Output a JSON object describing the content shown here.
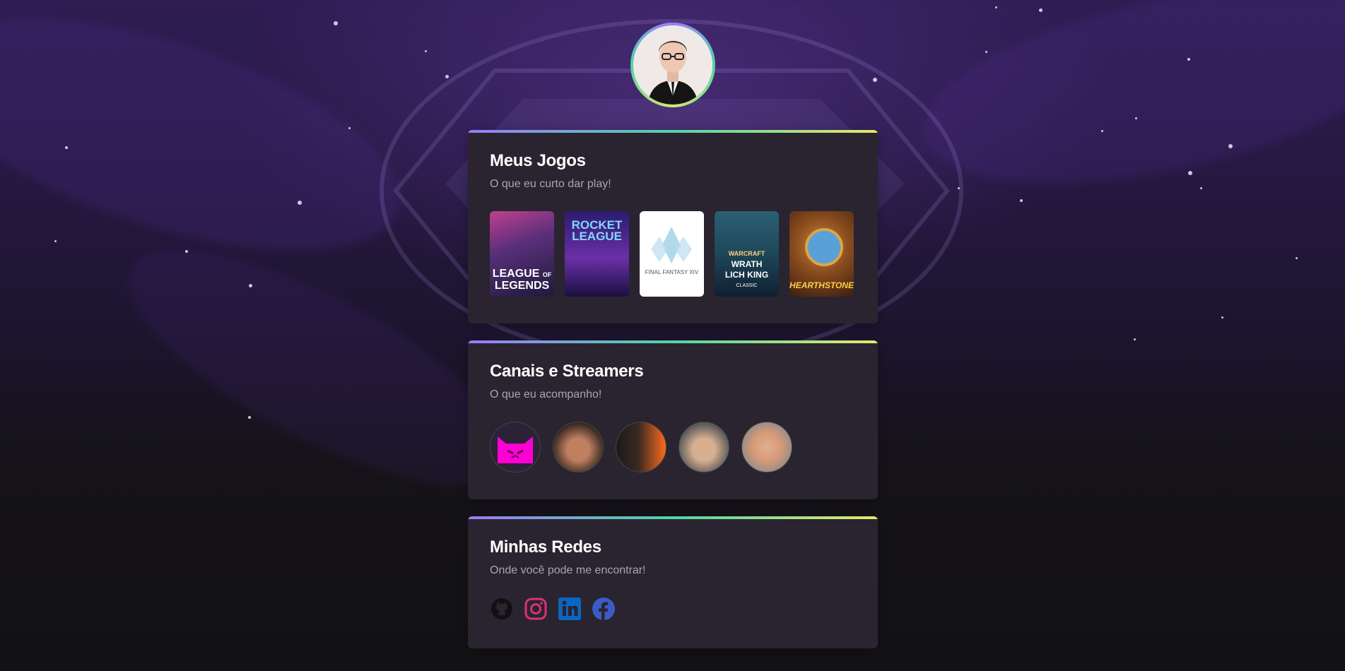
{
  "profile": {
    "avatar_alt": ""
  },
  "sections": {
    "games": {
      "title": "Meus Jogos",
      "subtitle": "O que eu curto dar play!",
      "items": [
        {
          "name": "League of Legends",
          "label_line1": "LEAGUE",
          "label_line2": "LEGENDS",
          "of": "OF",
          "colors": [
            "#5a2f7a",
            "#1d1a3a"
          ]
        },
        {
          "name": "Rocket League",
          "label_line1": "ROCKET",
          "label_line2": "LEAGUE",
          "colors": [
            "#2b1c6e",
            "#6a2fa8"
          ]
        },
        {
          "name": "Final Fantasy XIV",
          "label_line1": "FINAL FANTASY XIV",
          "colors": [
            "#ffffff",
            "#ffffff"
          ]
        },
        {
          "name": "World of Warcraft Wrath of the Lich King Classic",
          "label_line1": "WARCRAFT",
          "label_line2": "WRATH",
          "label_line3": "LICH KING",
          "label_line4": "CLASSIC",
          "colors": [
            "#1f4a5c",
            "#0f2030"
          ]
        },
        {
          "name": "Hearthstone",
          "label_line1": "HEARTHSTONE",
          "colors": [
            "#7a3f1a",
            "#3a1e10"
          ]
        }
      ]
    },
    "streamers": {
      "title": "Canais e Streamers",
      "subtitle": "O que eu acompanho!",
      "items": [
        {
          "name": "streamer-1",
          "colors": [
            "#2b2238",
            "#ff00d4"
          ]
        },
        {
          "name": "streamer-2",
          "colors": [
            "#3a2a22",
            "#c08060"
          ]
        },
        {
          "name": "streamer-3",
          "colors": [
            "#1a1a1a",
            "#ff6a1a"
          ]
        },
        {
          "name": "streamer-4",
          "colors": [
            "#5a5a5a",
            "#d8b090"
          ]
        },
        {
          "name": "streamer-5",
          "colors": [
            "#8a8a8a",
            "#e0b090"
          ]
        }
      ]
    },
    "networks": {
      "title": "Minhas Redes",
      "subtitle": "Onde você pode me encontrar!",
      "items": [
        {
          "name": "github",
          "icon": "github-icon",
          "color": "#111111"
        },
        {
          "name": "instagram",
          "icon": "instagram-icon",
          "color": "#d9317a"
        },
        {
          "name": "linkedin",
          "icon": "linkedin-icon",
          "color": "#0a66c2"
        },
        {
          "name": "facebook",
          "icon": "facebook-icon",
          "color": "#3b5cc4"
        }
      ]
    }
  }
}
